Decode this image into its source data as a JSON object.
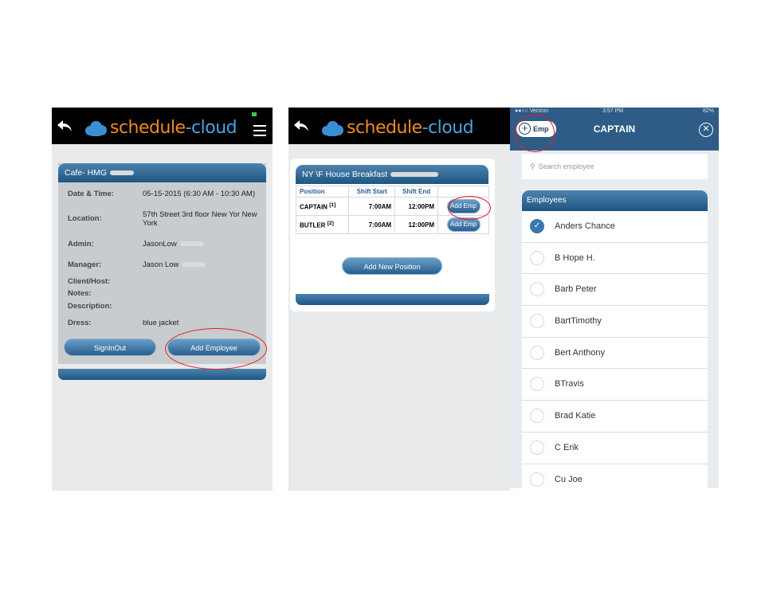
{
  "app": {
    "logo_part1": "schedule",
    "logo_part2": "-cloud"
  },
  "screen1": {
    "event_title": "Cafe- HMG",
    "fields": [
      {
        "label": "Date & Time:",
        "value": "05-15-2015 (6:30 AM - 10:30 AM)"
      },
      {
        "label": "Location:",
        "value": "57th Street 3rd floor New Yor New York"
      },
      {
        "label": "Admin:",
        "value": "JasonLow"
      },
      {
        "label": "Manager:",
        "value": "Jason Low"
      },
      {
        "label": "Client/Host:",
        "value": ""
      },
      {
        "label": "Notes:",
        "value": ""
      },
      {
        "label": "Description:",
        "value": ""
      },
      {
        "label": "Dress:",
        "value": "blue jacket"
      }
    ],
    "signinout_label": "SignInOut",
    "add_employee_label": "Add Employee"
  },
  "screen2": {
    "event_title": "NY \\F House Breakfast",
    "columns": [
      "Position",
      "Shift Start",
      "Shift End",
      ""
    ],
    "rows": [
      {
        "position": "CAPTAIN",
        "count": "[1]",
        "start": "7:00AM",
        "end": "12:00PM",
        "action": "Add Emp"
      },
      {
        "position": "BUTLER",
        "count": "[2]",
        "start": "7:00AM",
        "end": "12:00PM",
        "action": "Add Emp"
      }
    ],
    "add_position_label": "Add New Position"
  },
  "screen3": {
    "status_carrier": "●●○○ Verizon",
    "status_time": "3:57 PM",
    "status_battery": "82%",
    "add_emp_label": "Emp",
    "title": "CAPTAIN",
    "search_placeholder": "Search employee",
    "employees_header": "Employees",
    "employees": [
      {
        "name": "Anders Chance",
        "selected": true
      },
      {
        "name": "B Hope H.",
        "selected": false
      },
      {
        "name": "Barb Peter",
        "selected": false
      },
      {
        "name": "BartTimothy",
        "selected": false
      },
      {
        "name": "Bert Anthony",
        "selected": false
      },
      {
        "name": "BTravis",
        "selected": false
      },
      {
        "name": "Brad Katie",
        "selected": false
      },
      {
        "name": "C Erik",
        "selected": false
      },
      {
        "name": "Cu Joe",
        "selected": false
      }
    ]
  }
}
